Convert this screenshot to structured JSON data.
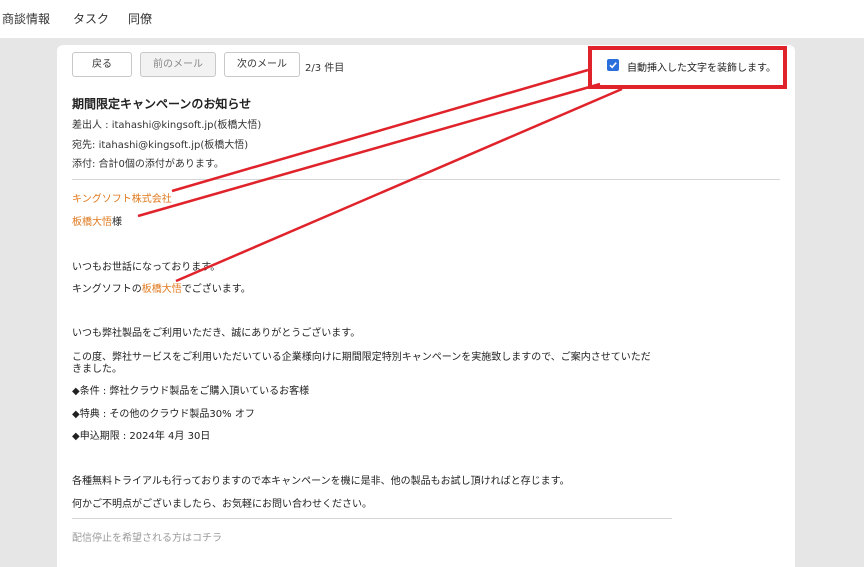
{
  "nav": {
    "tabs": [
      "商談情報",
      "タスク",
      "同僚"
    ]
  },
  "toolbar": {
    "back": "戻る",
    "prev": "前のメール",
    "next": "次のメール",
    "count": "2/3 件目"
  },
  "option": {
    "checked": true,
    "label": "自動挿入した文字を装飾します。"
  },
  "email": {
    "subject": "期間限定キャンペーンのお知らせ",
    "from_label": "差出人 : ",
    "from": "itahashi@kingsoft.jp(板橋大悟)",
    "to_label": "宛先: ",
    "to": "itahashi@kingsoft.jp(板橋大悟)",
    "attachment": "添付: 合計0個の添付があります。",
    "company": "キングソフト株式会社",
    "recipient_name": "板橋大悟",
    "honorific": "様",
    "greeting": "いつもお世話になっております。",
    "self_intro_pre": "キングソフトの",
    "sender_name": "板橋大悟",
    "self_intro_post": "でございます。",
    "thanks": "いつも弊社製品をご利用いただき、誠にありがとうございます。",
    "campaign_line1": "この度、弊社サービスをご利用いただいている企業様向けに期間限定特別キャンペーンを実施致しますので、ご案内させていただ",
    "campaign_line2": "きました。",
    "bullet1": "◆条件 : 弊社クラウド製品をご購入頂いているお客様",
    "bullet2": "◆特典 : その他のクラウド製品30% オフ",
    "bullet3": "◆申込期限 : 2024年 4月 30日",
    "trial": "各種無料トライアルも行っておりますので本キャンペーンを機に是非、他の製品もお試し頂ければと存じます。",
    "inquiry": "何かご不明点がございましたら、お気軽にお問い合わせください。",
    "unsubscribe": "配信停止を希望される方はコチラ"
  },
  "colors": {
    "highlight": "#e07a1f",
    "annotation": "#e0232b",
    "checkbox": "#2b6fdc"
  }
}
